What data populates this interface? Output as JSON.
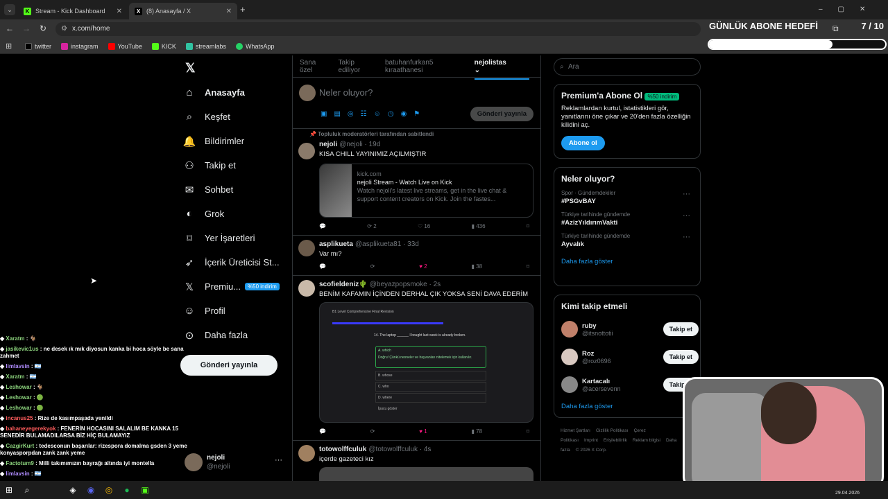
{
  "browser": {
    "tabs": [
      {
        "title": "Stream - Kick Dashboard",
        "close": "✕"
      },
      {
        "title": "(8) Anasayfa / X",
        "close": "✕"
      }
    ],
    "new_tab": "+",
    "url": "x.com/home",
    "bookmarks": [
      "twitter",
      "instagram",
      "YouTube",
      "KICK",
      "streamlabs",
      "WhatsApp"
    ]
  },
  "overlay": {
    "goal_title": "GÜNLÜK ABONE HEDEFİ",
    "goal_count": "7 / 10",
    "goal_fraction": 0.7
  },
  "sidebar": {
    "items": [
      {
        "label": "Anasayfa",
        "icon": "home-icon"
      },
      {
        "label": "Keşfet",
        "icon": "search-icon"
      },
      {
        "label": "Bildirimler",
        "icon": "bell-icon"
      },
      {
        "label": "Takip et",
        "icon": "follow-icon"
      },
      {
        "label": "Sohbet",
        "icon": "chat-icon"
      },
      {
        "label": "Grok",
        "icon": "grok-icon"
      },
      {
        "label": "Yer İşaretleri",
        "icon": "bookmark-icon"
      },
      {
        "label": "İçerik Üreticisi St...",
        "icon": "rocket-icon"
      },
      {
        "label": "Premiu...",
        "icon": "x-icon"
      },
      {
        "label": "Profil",
        "icon": "profile-icon"
      },
      {
        "label": "Daha fazla",
        "icon": "more-icon"
      }
    ],
    "premium_badge": "%50 indirim",
    "post_button": "Gönderi yayınla",
    "me": {
      "name": "nejoli",
      "handle": "@nejoli",
      "more": "···"
    }
  },
  "feed": {
    "tabs": [
      "Sana özel",
      "Takip ediliyor",
      "batuhanfurkan5 kıraathanesi",
      "nejolistas"
    ],
    "composer": {
      "placeholder": "Neler oluyor?",
      "post": "Gönderi yayınla"
    },
    "pinned_note": "Topluluk moderatörleri tarafından sabitlendi",
    "posts": [
      {
        "name": "nejoli",
        "handle": "@nejoli · 19d",
        "text": "KISA CHILL YAYINIMIZ AÇILMIŞTIR",
        "card": {
          "domain": "kick.com",
          "title": "nejoli Stream - Watch Live on Kick",
          "desc": "Watch nejoli's latest live streams, get in the live chat & support content creators on Kick. Join the fastes..."
        },
        "retweets": "2",
        "likes": "16",
        "views": "436"
      },
      {
        "name": "asplikueta",
        "handle": "@asplikueta81 · 33d",
        "text": "Var mı?",
        "retweets": "",
        "likes": "2",
        "views": "38"
      },
      {
        "name": "scofieldeniz🌵",
        "handle": "@beyazpopsmoke · 2s",
        "text": "BENİM KAFAMIN İÇİNDEN DERHAL ÇIK YOKSA SENİ DAVA EDERİM",
        "retweets": "",
        "likes": "1",
        "views": "78",
        "quiz": {
          "header": "B1 Level Comprehensive Final Revision",
          "question": "14.   The laptop ______ I bought last week is already broken.",
          "options": [
            "A.  which",
            "Doğru! Çünkü nesneler ve hayvanları nitelemek için kullanılır.",
            "B.  whose",
            "C.  who",
            "D.  where"
          ],
          "hint": "İpucu göster"
        }
      },
      {
        "name": "totowolffculuk",
        "handle": "@totowolffculuk · 4s",
        "text": "içerde gazeteci kız"
      }
    ]
  },
  "right": {
    "search_placeholder": "Ara",
    "premium": {
      "title": "Premium'a Abone Ol",
      "badge": "%50 indirim",
      "text": "Reklamlardan kurtul, istatistikleri gör, yanıtlarını öne çıkar ve 20'den fazla özelliğin kilidini aç.",
      "button": "Abone ol"
    },
    "trends_title": "Neler oluyor?",
    "trends": [
      {
        "cat": "Spor · Gündemdekiler",
        "name": "#PSGvBAY"
      },
      {
        "cat": "Türkiye tarihinde gündemde",
        "name": "#AzizYıldırımVakti"
      },
      {
        "cat": "Türkiye tarihinde gündemde",
        "name": "Ayvalık"
      }
    ],
    "show_more": "Daha fazla göster",
    "who_title": "Kimi takip etmeli",
    "who": [
      {
        "name": "ruby",
        "handle": "@itsnottotii"
      },
      {
        "name": "Roz",
        "handle": "@roz0696"
      },
      {
        "name": "Kartacalı",
        "handle": "@acersevenn"
      }
    ],
    "follow": "Takip et",
    "footer": [
      "Hizmet Şartları",
      "Gizlilik Politikası",
      "Çerez Politikası",
      "Imprint",
      "Erişilebilirlik",
      "Reklam bilgisi",
      "Daha fazla",
      "© 2026 X Corp."
    ]
  },
  "chat": [
    {
      "user": "Xaratm",
      "msg": ": 🐐",
      "color": "#8bd17c"
    },
    {
      "user": "jasikevic1us",
      "msg": ": ne desek ık mık diyosun kanka bi hoca söyle be sana zahmet",
      "color": "#8bd17c"
    },
    {
      "user": "limlavsin",
      "msg": ": 🇦🇷",
      "color": "#b08cff"
    },
    {
      "user": "Xaratm",
      "msg": ": 🇦🇷",
      "color": "#8bd17c"
    },
    {
      "user": "Leshowar",
      "msg": ": 🐐",
      "color": "#8bd17c"
    },
    {
      "user": "Leshowar",
      "msg": ": 🟢",
      "color": "#8bd17c"
    },
    {
      "user": "Leshowar",
      "msg": ": 🟢",
      "color": "#8bd17c"
    },
    {
      "user": "incanus25",
      "msg": ": Rize de kasımpaşada yenildi",
      "color": "#ff5c5c"
    },
    {
      "user": "bahaneyegerekyok",
      "msg": ": FENERİN HOCASINI SALALIM BE KANKA 15 SENEDİR BULAMADILARSA BİZ HİÇ BULAMAYIZ",
      "color": "#ff5c5c"
    },
    {
      "user": "CazgirKurt",
      "msg": ": tedesconun başarılar: rizespora domalma gsden 3 yeme konyasporpdan zank zank yeme",
      "color": "#8bd17c"
    },
    {
      "user": "Factotum9",
      "msg": ": Milli takımımızın bayrağı altında iyi montella",
      "color": "#8bd17c"
    },
    {
      "user": "limlavsin",
      "msg": ": 🇦🇷",
      "color": "#b08cff"
    }
  ],
  "taskbar": {
    "date": "29.04.2026"
  }
}
